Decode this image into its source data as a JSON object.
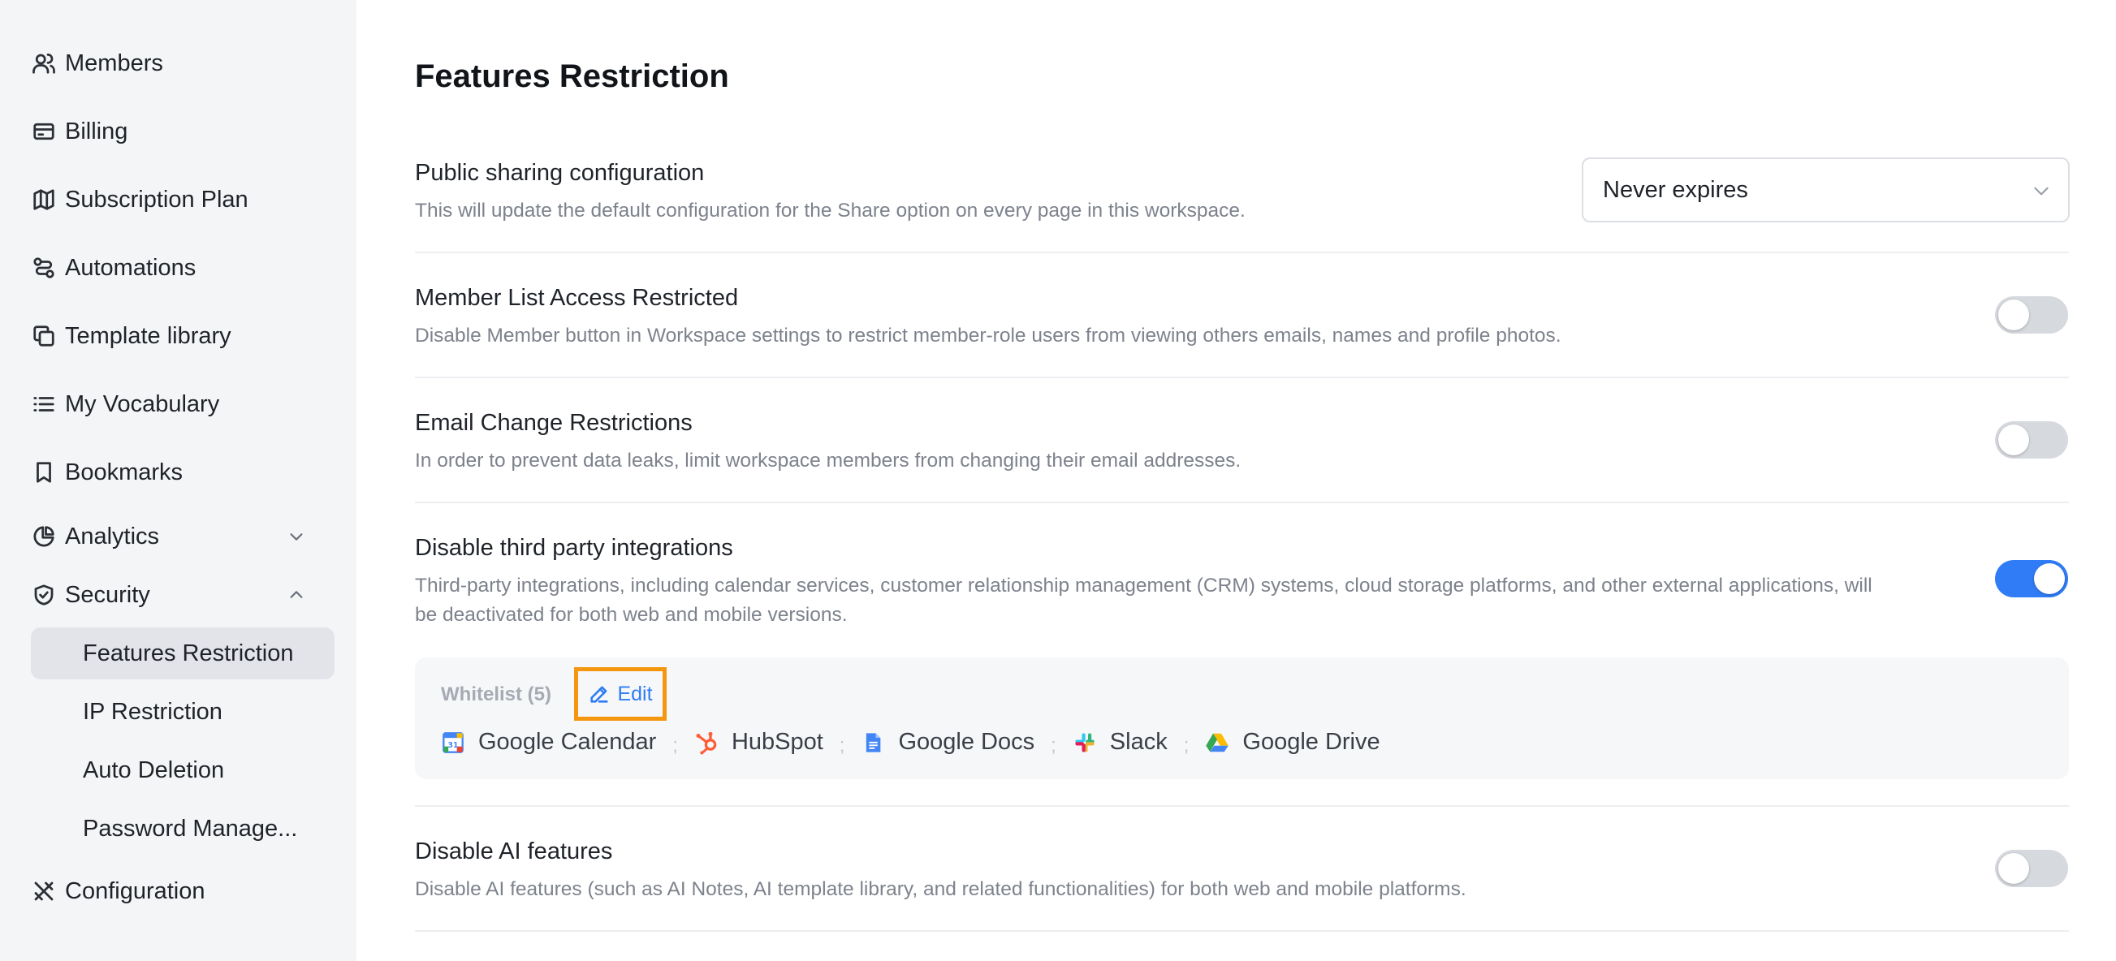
{
  "sidebar": {
    "items": [
      {
        "label": "Members",
        "icon": "users-icon"
      },
      {
        "label": "Billing",
        "icon": "credit-card-icon"
      },
      {
        "label": "Subscription Plan",
        "icon": "map-icon"
      },
      {
        "label": "Automations",
        "icon": "route-icon"
      },
      {
        "label": "Template library",
        "icon": "copy-icon"
      },
      {
        "label": "My Vocabulary",
        "icon": "list-icon"
      },
      {
        "label": "Bookmarks",
        "icon": "bookmark-icon"
      },
      {
        "label": "Analytics",
        "icon": "pie-chart-icon",
        "expanded": false
      },
      {
        "label": "Security",
        "icon": "shield-check-icon",
        "expanded": true
      },
      {
        "label": "Configuration",
        "icon": "tools-icon"
      }
    ],
    "security_subitems": [
      {
        "label": "Features Restriction",
        "active": true
      },
      {
        "label": "IP Restriction",
        "active": false
      },
      {
        "label": "Auto Deletion",
        "active": false
      },
      {
        "label": "Password Manage...",
        "active": false
      }
    ]
  },
  "main": {
    "title": "Features Restriction",
    "public_sharing": {
      "title": "Public sharing configuration",
      "description": "This will update the default configuration for the Share option on every page in this workspace.",
      "selected_value": "Never expires"
    },
    "member_list": {
      "title": "Member List Access Restricted",
      "description": "Disable Member button in Workspace settings to restrict member-role users from viewing others emails, names and profile photos.",
      "enabled": false
    },
    "email_change": {
      "title": "Email Change Restrictions",
      "description": "In order to prevent data leaks, limit workspace members from changing their email addresses.",
      "enabled": false
    },
    "third_party": {
      "title": "Disable third party integrations",
      "description_line1": "Third-party integrations, including calendar services, customer relationship management (CRM) systems, cloud storage platforms, and other external applications, will",
      "description_line2": "be deactivated for both web and mobile versions.",
      "enabled": true,
      "whitelist_label": "Whitelist (5)",
      "edit_label": "Edit",
      "whitelist": [
        {
          "name": "Google Calendar",
          "icon": "google-calendar-icon"
        },
        {
          "name": "HubSpot",
          "icon": "hubspot-icon"
        },
        {
          "name": "Google Docs",
          "icon": "google-docs-icon"
        },
        {
          "name": "Slack",
          "icon": "slack-icon"
        },
        {
          "name": "Google Drive",
          "icon": "google-drive-icon"
        }
      ],
      "separator": ";"
    },
    "ai_features": {
      "title": "Disable AI features",
      "description": "Disable AI features (such as AI Notes, AI template library, and related functionalities) for both web and mobile platforms.",
      "enabled": false
    }
  },
  "colors": {
    "accent": "#2f7cf6",
    "highlight": "#f5960f",
    "sidebar_bg": "#f4f5f7",
    "active_item_bg": "#e2e4e9"
  }
}
